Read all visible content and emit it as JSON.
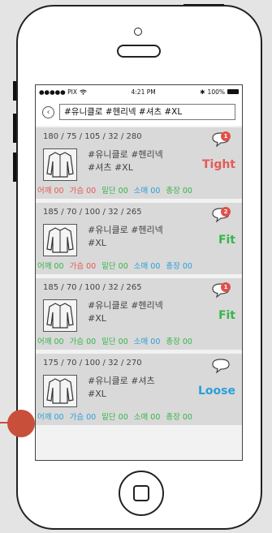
{
  "status": {
    "carrier": "●●●●● PIX",
    "time": "4:21 PM",
    "battery": "100%"
  },
  "search": {
    "query": "#유니클로 #헨리넥 #셔츠 #XL"
  },
  "cards": [
    {
      "measure": "180 / 75 / 105 / 32 / 280",
      "tags1": "#유니클로 #헨리넥",
      "tags2": "#셔츠 #XL",
      "badge": "1",
      "verdict": "Tight",
      "metrics": [
        "어깨 00",
        "가슴 00",
        "밑단 00",
        "소매 00",
        "총장 00"
      ]
    },
    {
      "measure": "185 / 70 / 100 / 32 / 265",
      "tags1": "#유니클로 #헨리넥",
      "tags2": "#XL",
      "badge": "2",
      "verdict": "Fit",
      "metrics": [
        "어깨 00",
        "가슴 00",
        "밑단 00",
        "소매 00",
        "총장 00"
      ]
    },
    {
      "measure": "185 / 70 / 100 / 32 / 265",
      "tags1": "#유니클로 #헨리넥",
      "tags2": "#XL",
      "badge": "1",
      "verdict": "Fit",
      "metrics": [
        "어깨 00",
        "가슴 00",
        "밑단 00",
        "소매 00",
        "총장 00"
      ]
    },
    {
      "measure": "175 / 70 / 100 / 32 / 270",
      "tags1": "#유니클로 #셔츠",
      "tags2": "#XL",
      "badge": "",
      "verdict": "Loose",
      "metrics": [
        "어깨 00",
        "가슴 00",
        "밑단 00",
        "소매 00",
        "총장 00"
      ]
    }
  ],
  "colors": {
    "red": "#e55a55",
    "green": "#37b54a",
    "blue": "#2a9fd8",
    "badge": "#e0504a"
  },
  "icons": [
    "back-icon",
    "chat-bubble-icon",
    "jacket-icon",
    "wifi-icon",
    "bluetooth-icon",
    "battery-icon"
  ]
}
